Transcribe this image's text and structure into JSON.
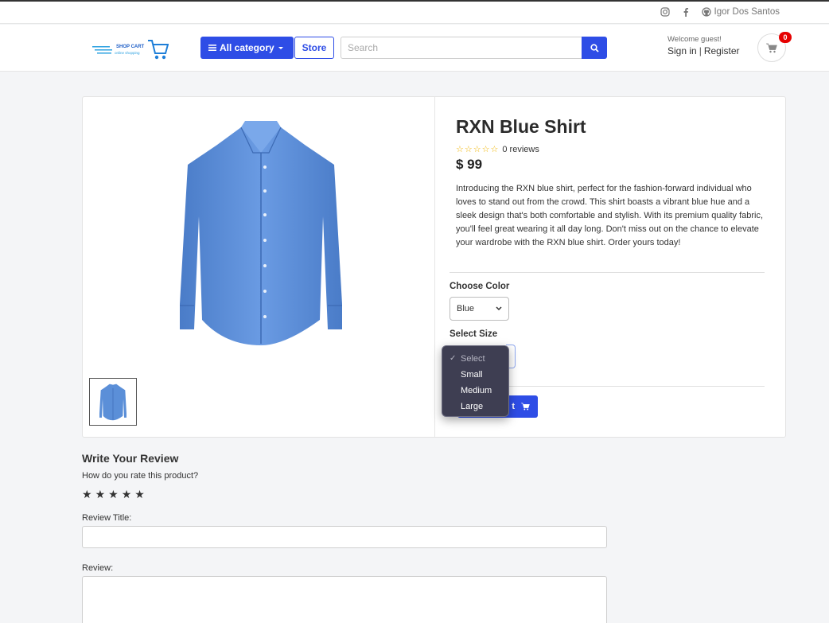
{
  "topbar": {
    "author": "Igor Dos Santos",
    "icons": [
      "instagram-icon",
      "facebook-icon",
      "github-icon"
    ]
  },
  "header": {
    "logo_text": "SHOP CART",
    "logo_tagline": "online shopping",
    "category_button": "All category",
    "store_button": "Store",
    "search_placeholder": "Search",
    "welcome": "Welcome guest!",
    "sign_in": "Sign in",
    "separator": "|",
    "register": "Register",
    "cart_count": "0"
  },
  "product": {
    "title": "RXN Blue Shirt",
    "rating_stars": 0,
    "rating_max": 5,
    "reviews": "0 reviews",
    "price": "$ 99",
    "description": "Introducing the RXN blue shirt, perfect for the fashion-forward individual who loves to stand out from the crowd. This shirt boasts a vibrant blue hue and a sleek design that's both comfortable and stylish. With its premium quality fabric, you'll feel great wearing it all day long. Don't miss out on the chance to elevate your wardrobe with the RXN blue shirt. Order yours today!",
    "color_label": "Choose Color",
    "color_value": "Blue",
    "size_label": "Select Size",
    "add_button_partial": "t",
    "size_options": [
      {
        "label": "Select",
        "selected": true
      },
      {
        "label": "Small",
        "selected": false
      },
      {
        "label": "Medium",
        "selected": false
      },
      {
        "label": "Large",
        "selected": false
      }
    ]
  },
  "review": {
    "heading": "Write Your Review",
    "question": "How do you rate this product?",
    "stars": 5,
    "title_label": "Review Title:",
    "review_label": "Review:"
  },
  "colors": {
    "primary": "#2e4de6",
    "badge": "#e60000",
    "star": "#f0b400",
    "shirt": "#5b8fd8"
  }
}
